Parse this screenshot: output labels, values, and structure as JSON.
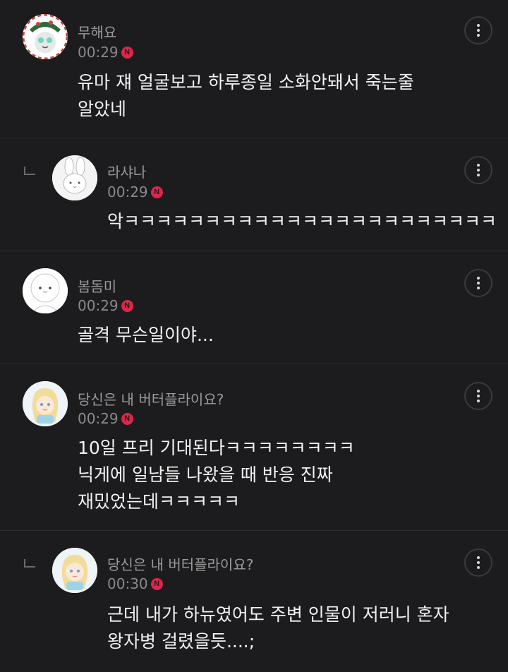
{
  "comments": [
    {
      "author": "무해요",
      "time": "00:29",
      "badge": "N",
      "lines": [
        "유마 쟤 얼굴보고 하루종일 소화안돼서 죽는줄",
        "알았네"
      ],
      "avatar": "christmas-wreath-avatar",
      "is_reply": false
    },
    {
      "author": "라샤나",
      "time": "00:29",
      "badge": "N",
      "lines": [
        "악ㅋㅋㅋㅋㅋㅋㅋㅋㅋㅋㅋㅋㅋㅋㅋㅋㅋㅋㅋㅋㅋㅋㅋ"
      ],
      "avatar": "bunny-avatar",
      "is_reply": true
    },
    {
      "author": "봄돔미",
      "time": "00:29",
      "badge": "N",
      "lines": [
        "골격 무슨일이야..."
      ],
      "avatar": "white-character-avatar",
      "is_reply": false
    },
    {
      "author": "당신은 내 버터플라이요?",
      "time": "00:29",
      "badge": "N",
      "lines": [
        "10일 프리 기대된다ㅋㅋㅋㅋㅋㅋㅋㅋ",
        "닉게에 일남들 나왔을 때 반응 진짜",
        "재밌었는데ㅋㅋㅋㅋㅋ"
      ],
      "avatar": "blonde-girl-avatar",
      "is_reply": false
    },
    {
      "author": "당신은 내 버터플라이요?",
      "time": "00:30",
      "badge": "N",
      "lines": [
        "근데 내가 하뉴였어도 주변 인물이 저러니 혼자",
        "왕자병 걸렸을듯....;"
      ],
      "avatar": "blonde-girl-avatar",
      "is_reply": true
    }
  ],
  "colors": {
    "background": "#1c1c1e",
    "divider": "#2c2c2e",
    "new_badge": "#e0254a",
    "author_text": "#9a9a9a",
    "body_text": "#f2f2f2"
  },
  "icons": {
    "more": "vertical-ellipsis-icon",
    "reply": "reply-corner-icon"
  }
}
